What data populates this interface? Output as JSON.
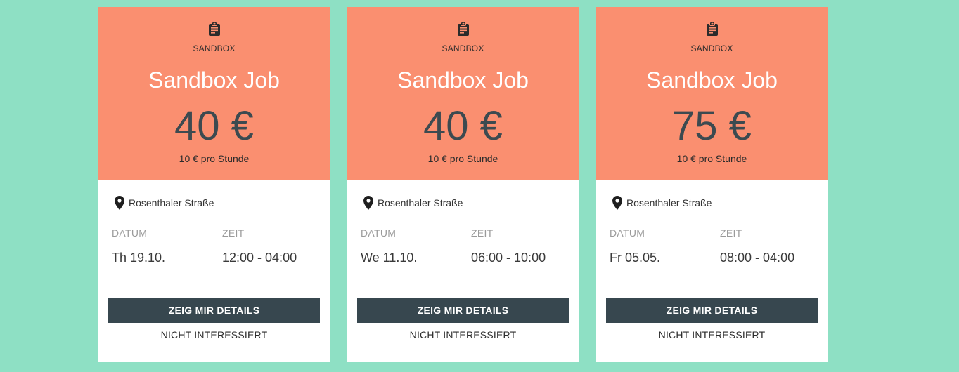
{
  "colors": {
    "background": "#8ee0c4",
    "card_header": "#fa8f70",
    "button": "#37474f"
  },
  "cards": [
    {
      "category_icon": "clipboard-icon",
      "category": "SANDBOX",
      "title": "Sandbox Job",
      "price": "40 €",
      "hourly": "10 € pro Stunde",
      "location_icon": "map-pin-icon",
      "location": "Rosenthaler Straße",
      "date_label": "DATUM",
      "time_label": "ZEIT",
      "date": "Th 19.10.",
      "time": "12:00 - 04:00",
      "details_label": "ZEIG MIR DETAILS",
      "not_interested_label": "NICHT INTERESSIERT"
    },
    {
      "category_icon": "clipboard-icon",
      "category": "SANDBOX",
      "title": "Sandbox Job",
      "price": "40 €",
      "hourly": "10 € pro Stunde",
      "location_icon": "map-pin-icon",
      "location": "Rosenthaler Straße",
      "date_label": "DATUM",
      "time_label": "ZEIT",
      "date": "We 11.10.",
      "time": "06:00 - 10:00",
      "details_label": "ZEIG MIR DETAILS",
      "not_interested_label": "NICHT INTERESSIERT"
    },
    {
      "category_icon": "clipboard-icon",
      "category": "SANDBOX",
      "title": "Sandbox Job",
      "price": "75 €",
      "hourly": "10 € pro Stunde",
      "location_icon": "map-pin-icon",
      "location": "Rosenthaler Straße",
      "date_label": "DATUM",
      "time_label": "ZEIT",
      "date": "Fr 05.05.",
      "time": "08:00 - 04:00",
      "details_label": "ZEIG MIR DETAILS",
      "not_interested_label": "NICHT INTERESSIERT"
    }
  ]
}
